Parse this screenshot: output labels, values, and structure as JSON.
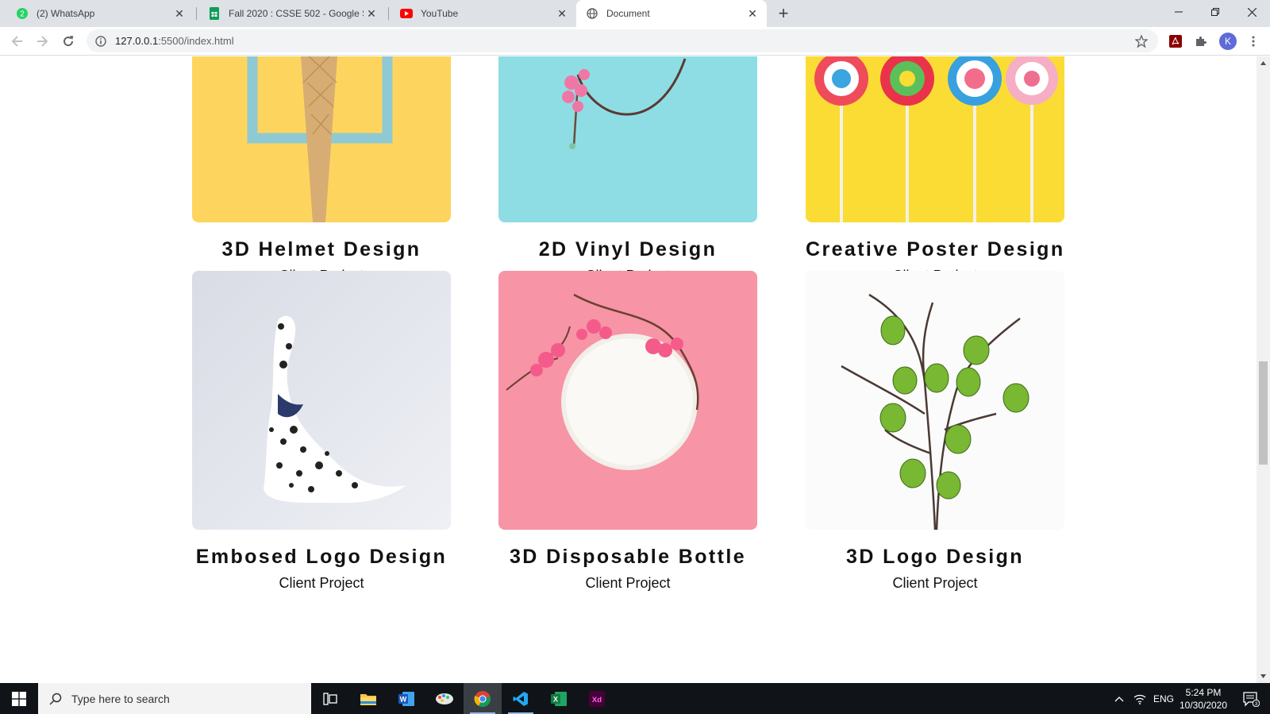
{
  "browser": {
    "tabs": [
      {
        "title": "(2) WhatsApp",
        "icon": "whatsapp-icon",
        "active": false
      },
      {
        "title": "Fall 2020 : CSSE 502 - Google Sheets",
        "icon": "google-sheets-icon",
        "active": false
      },
      {
        "title": "YouTube",
        "icon": "youtube-icon",
        "active": false
      },
      {
        "title": "Document",
        "icon": "globe-icon",
        "active": true
      }
    ],
    "address": {
      "host": "127.0.0.1",
      "path": ":5500/index.html"
    },
    "profile_initial": "K"
  },
  "portfolio": {
    "items": [
      {
        "title": "3D Helmet Design",
        "subtitle": "Client Project",
        "image": "ice-cream-cone-in-frame"
      },
      {
        "title": "2D Vinyl Design",
        "subtitle": "Client Project",
        "image": "pink-flowers-on-blue"
      },
      {
        "title": "Creative Poster Design",
        "subtitle": "Client Project",
        "image": "lollipops-on-yellow"
      },
      {
        "title": "Embosed Logo Design",
        "subtitle": "Client Project",
        "image": "dalmatian-dog"
      },
      {
        "title": "3D Disposable Bottle",
        "subtitle": "Client Project",
        "image": "plate-with-flowers-on-pink"
      },
      {
        "title": "3D Logo Design",
        "subtitle": "Client Project",
        "image": "green-eggs-on-branch"
      }
    ]
  },
  "taskbar": {
    "search_placeholder": "Type here to search",
    "apps": [
      "task-view-icon",
      "file-explorer-icon",
      "word-icon",
      "paint-icon",
      "chrome-icon",
      "vscode-icon",
      "excel-icon",
      "adobe-xd-icon"
    ],
    "language": "ENG",
    "time": "5:24 PM",
    "date": "10/30/2020",
    "notification_count": "3",
    "xd_label": "Xd",
    "whatsapp_badge": "2"
  },
  "colors": {
    "tabstrip": "#dee1e6",
    "accent_avatar": "#5f6bd8",
    "taskbar": "#101418"
  }
}
